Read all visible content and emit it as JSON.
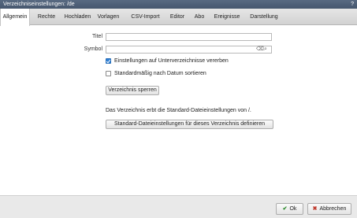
{
  "window": {
    "title": "Verzeichniseinstellungen: /de",
    "help": "?"
  },
  "tabs": [
    {
      "label": "Allgemein"
    },
    {
      "label": "Rechte"
    },
    {
      "label": "Hochladen"
    },
    {
      "label": "Vorlagen"
    },
    {
      "label": "CSV-Import"
    },
    {
      "label": "Editor"
    },
    {
      "label": "Abo"
    },
    {
      "label": "Ereignisse"
    },
    {
      "label": "Darstellung"
    }
  ],
  "form": {
    "title_label": "Titel",
    "title_value": "",
    "symbol_label": "Symbol",
    "symbol_value": "",
    "inherit_checkbox": {
      "label": "Einstellungen auf Unterverzeichnisse vererben",
      "checked": true
    },
    "sort_checkbox": {
      "label": "Standardmäßig nach Datum sortieren",
      "checked": false
    },
    "lock_button": "Verzeichnis sperren",
    "inherit_info": "Das Verzeichnis erbt die Standard-Dateieinstellungen von /.",
    "define_button": "Standard-Dateieinstellungen für dieses Verzeichnis definieren"
  },
  "footer": {
    "ok": "Ok",
    "cancel": "Abbrechen"
  }
}
